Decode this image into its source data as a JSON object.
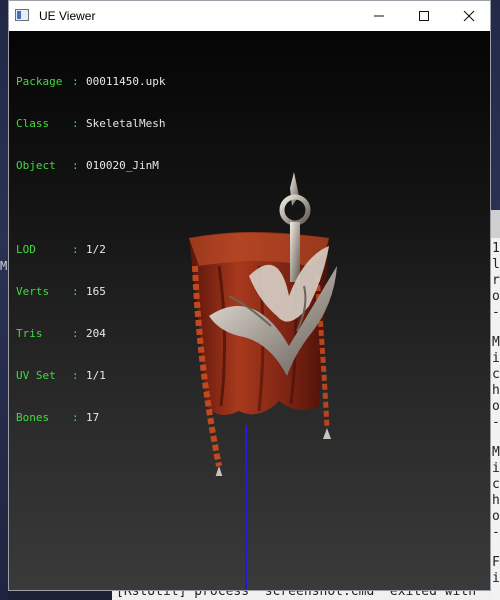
{
  "window": {
    "title": "UE Viewer",
    "icon": "app-window-icon",
    "controls": {
      "minimize": "–",
      "maximize": "☐",
      "close": "✕"
    }
  },
  "info": {
    "package": {
      "key": "Package",
      "sep": ":",
      "value": "00011450.upk"
    },
    "class": {
      "key": "Class",
      "sep": ":",
      "value": "SkeletalMesh"
    },
    "object": {
      "key": "Object",
      "sep": ":",
      "value": "010020_JinM"
    },
    "lod": {
      "key": "LOD",
      "sep": ":",
      "value": "1/2"
    },
    "verts": {
      "key": "Verts",
      "sep": ":",
      "value": "165"
    },
    "tris": {
      "key": "Tris",
      "sep": ":",
      "value": "204"
    },
    "uvset": {
      "key": "UV Set",
      "sep": ":",
      "value": "1/1"
    },
    "bones": {
      "key": "Bones",
      "sep": ":",
      "value": "17"
    }
  },
  "console_bottom": "[RstUtil] process \"screenshot.cmd\" exited with",
  "side_console_lines": [
    "1",
    "l",
    "r",
    "o",
    "-",
    "M",
    "i",
    "c",
    "h",
    "o",
    "-",
    "M",
    "i",
    "c",
    "h",
    "o",
    "-",
    "F",
    "i"
  ],
  "desktop_left_glyph": "M",
  "colors": {
    "info_key": "#3fdc3f",
    "info_value": "#e8e8e8",
    "axis": "#1d1ddb",
    "cloth": "#8e2a17",
    "metal": "#c9c3bc"
  }
}
